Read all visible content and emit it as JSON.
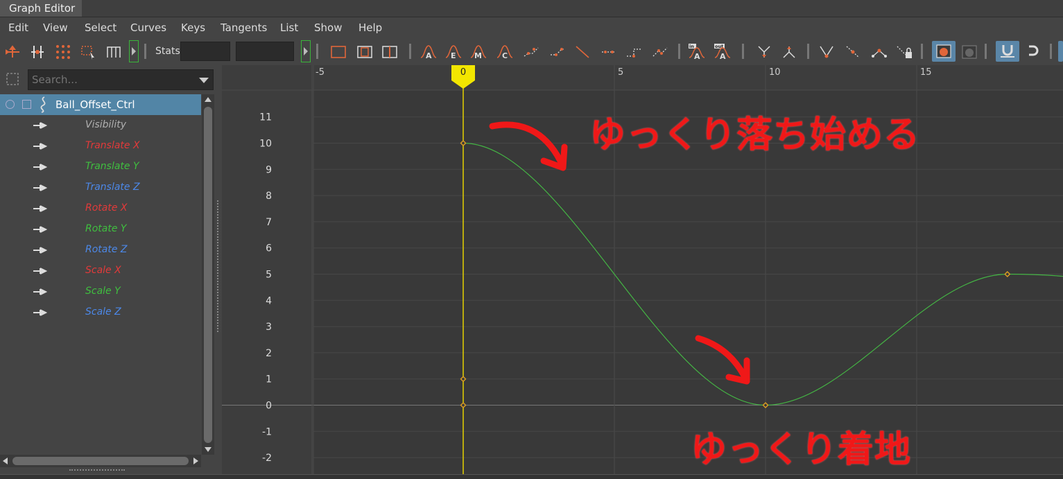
{
  "window": {
    "title": "Graph Editor"
  },
  "menu": [
    "Edit",
    "View",
    "Select",
    "Curves",
    "Keys",
    "Tangents",
    "List",
    "Show",
    "Help"
  ],
  "toolbar": {
    "stats_label": "Stats",
    "stats_value_1": "",
    "stats_value_2": "",
    "tangent_letters": [
      "A",
      "E",
      "M",
      "C"
    ],
    "infinity_in_label": "in",
    "infinity_out_label": "out",
    "infinity_letter": "A"
  },
  "outliner": {
    "search_placeholder": "Search...",
    "node": "Ball_Offset_Ctrl",
    "attributes": [
      {
        "label": "Visibility",
        "color": "#b0b0b0"
      },
      {
        "label": "Translate X",
        "color": "#e23a3a"
      },
      {
        "label": "Translate Y",
        "color": "#3fbf3f"
      },
      {
        "label": "Translate Z",
        "color": "#4c88e8"
      },
      {
        "label": "Rotate X",
        "color": "#e23a3a"
      },
      {
        "label": "Rotate Y",
        "color": "#3fbf3f"
      },
      {
        "label": "Rotate Z",
        "color": "#4c88e8"
      },
      {
        "label": "Scale X",
        "color": "#e23a3a"
      },
      {
        "label": "Scale Y",
        "color": "#3fbf3f"
      },
      {
        "label": "Scale Z",
        "color": "#4c88e8"
      }
    ]
  },
  "graph": {
    "time_ticks": [
      "-5",
      "0",
      "5",
      "10",
      "15"
    ],
    "value_ticks": [
      "11",
      "10",
      "9",
      "8",
      "7",
      "6",
      "5",
      "4",
      "3",
      "2",
      "1",
      "0",
      "-1",
      "-2"
    ],
    "current_frame": "0",
    "curve_color": "#44b444",
    "keys": [
      {
        "frame": 0,
        "value": 10
      },
      {
        "frame": 10,
        "value": 0
      },
      {
        "frame": 18,
        "value": 5
      }
    ],
    "extra_markers": [
      {
        "frame": 0,
        "value": 1
      },
      {
        "frame": 0,
        "value": 0
      }
    ]
  },
  "annotations": {
    "top": "ゆっくり落ち始める",
    "bottom": "ゆっくり着地",
    "color": "#f01818"
  }
}
